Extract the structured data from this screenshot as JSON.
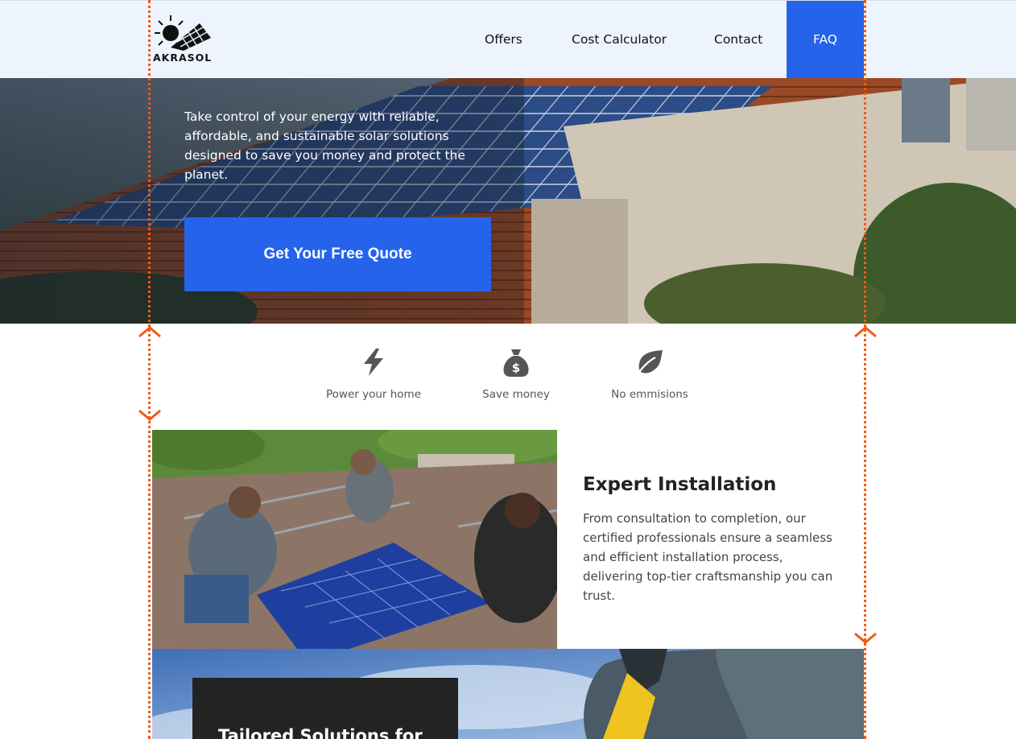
{
  "brand": {
    "name": "AKRASOL"
  },
  "nav": {
    "offers": "Offers",
    "cost_calculator": "Cost Calculator",
    "contact": "Contact",
    "faq": "FAQ"
  },
  "hero": {
    "text": "Take control of your energy with reliable, affordable, and sustainable solar solutions designed to save you money and protect the planet.",
    "cta": "Get Your Free Quote"
  },
  "features": [
    {
      "label": "Power your home",
      "icon": "lightning-bolt-icon"
    },
    {
      "label": "Save money",
      "icon": "money-bag-icon"
    },
    {
      "label": "No emmisions",
      "icon": "leaf-icon"
    }
  ],
  "install": {
    "title": "Expert Installation",
    "body": "From consultation to completion, our certified professionals ensure a seamless and efficient installation process, delivering top-tier craftsmanship you can trust."
  },
  "tailored": {
    "title": "Tailored Solutions for"
  },
  "colors": {
    "accent": "#2563eb",
    "guide": "#f15a13",
    "header_bg": "#eef4fe"
  }
}
